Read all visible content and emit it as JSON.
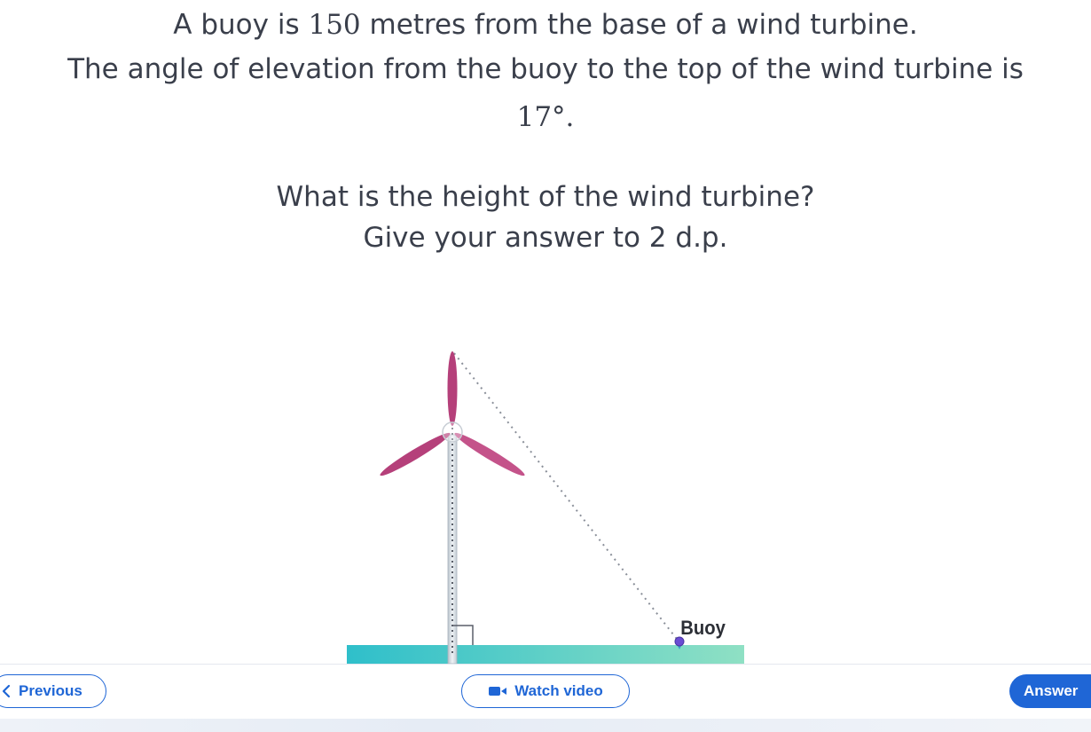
{
  "question": {
    "line1_pre": "A buoy is ",
    "line1_num": "150",
    "line1_post": " metres from the base of a wind turbine.",
    "line2": "The angle of elevation from the buoy to the top of the wind turbine is",
    "line3_angle": "17°",
    "line3_post": ".",
    "line4": "What is the height of the wind turbine?",
    "line5": "Give your answer to 2 d.p."
  },
  "diagram": {
    "buoy_label": "Buoy",
    "colors": {
      "blade": "#b5407a",
      "water_start": "#2fbfca",
      "water_end": "#8fe0c4",
      "buoy": "#6a4cd3",
      "dotted_line": "#8a8f99"
    }
  },
  "footer": {
    "previous_label": "Previous",
    "video_label": "Watch video",
    "answer_label": "Answer",
    "accent": "#1f66d6"
  },
  "icons": [
    "chevron-left-icon",
    "video-camera-icon"
  ]
}
